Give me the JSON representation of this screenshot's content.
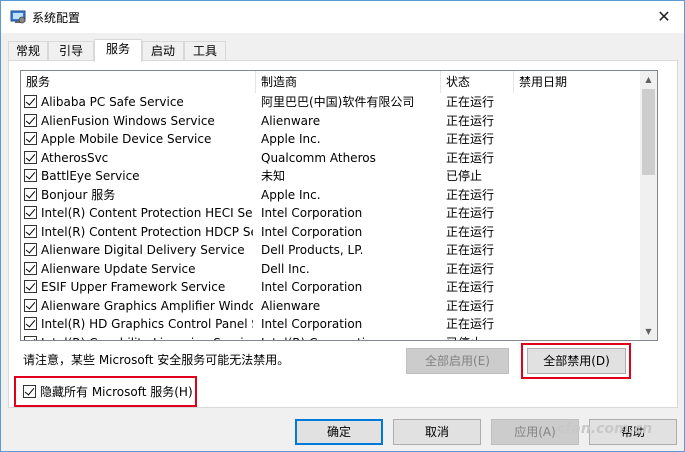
{
  "window": {
    "title": "系统配置",
    "close_glyph": "✕"
  },
  "tabs": [
    {
      "label": "常规"
    },
    {
      "label": "引导"
    },
    {
      "label": "服务",
      "active": true
    },
    {
      "label": "启动"
    },
    {
      "label": "工具"
    }
  ],
  "columns": [
    "服务",
    "制造商",
    "状态",
    "禁用日期"
  ],
  "rows": [
    {
      "service": "Alibaba PC Safe Service",
      "maker": "阿里巴巴(中国)软件有限公司",
      "status": "正在运行",
      "checked": true
    },
    {
      "service": "AlienFusion Windows Service",
      "maker": "Alienware",
      "status": "正在运行",
      "checked": true
    },
    {
      "service": "Apple Mobile Device Service",
      "maker": "Apple Inc.",
      "status": "正在运行",
      "checked": true
    },
    {
      "service": "AtherosSvc",
      "maker": "Qualcomm Atheros",
      "status": "正在运行",
      "checked": true
    },
    {
      "service": "BattlEye Service",
      "maker": "未知",
      "status": "已停止",
      "checked": true
    },
    {
      "service": "Bonjour 服务",
      "maker": "Apple Inc.",
      "status": "正在运行",
      "checked": true
    },
    {
      "service": "Intel(R) Content Protection HECI Ser...",
      "maker": "Intel Corporation",
      "status": "正在运行",
      "checked": true
    },
    {
      "service": "Intel(R) Content Protection HDCP Se...",
      "maker": "Intel Corporation",
      "status": "正在运行",
      "checked": true
    },
    {
      "service": "Alienware Digital Delivery Service",
      "maker": "Dell Products, LP.",
      "status": "正在运行",
      "checked": true
    },
    {
      "service": "Alienware Update Service",
      "maker": "Dell Inc.",
      "status": "正在运行",
      "checked": true
    },
    {
      "service": "ESIF Upper Framework Service",
      "maker": "Intel Corporation",
      "status": "正在运行",
      "checked": true
    },
    {
      "service": "Alienware Graphics Amplifier Windo...",
      "maker": "Alienware",
      "status": "正在运行",
      "checked": true
    },
    {
      "service": "Intel(R) HD Graphics Control Panel S...",
      "maker": "Intel Corporation",
      "status": "正在运行",
      "checked": true
    },
    {
      "service": "Intel(R) Capability Licensing Service ...",
      "maker": "Intel(R) Corporation",
      "status": "已停止",
      "checked": true
    }
  ],
  "note": "请注意，某些 Microsoft 安全服务可能无法禁用。",
  "buttons": {
    "enable_all": "全部启用(E)",
    "disable_all": "全部禁用(D)",
    "ok": "确定",
    "cancel": "取消",
    "apply": "应用(A)",
    "help": "帮助"
  },
  "hide_ms": {
    "label": "隐藏所有 Microsoft 服务(H)",
    "checked": true
  },
  "watermark": "cfan.com.cn",
  "colors": {
    "highlight": "#e0001b",
    "accent": "#0078d7"
  }
}
